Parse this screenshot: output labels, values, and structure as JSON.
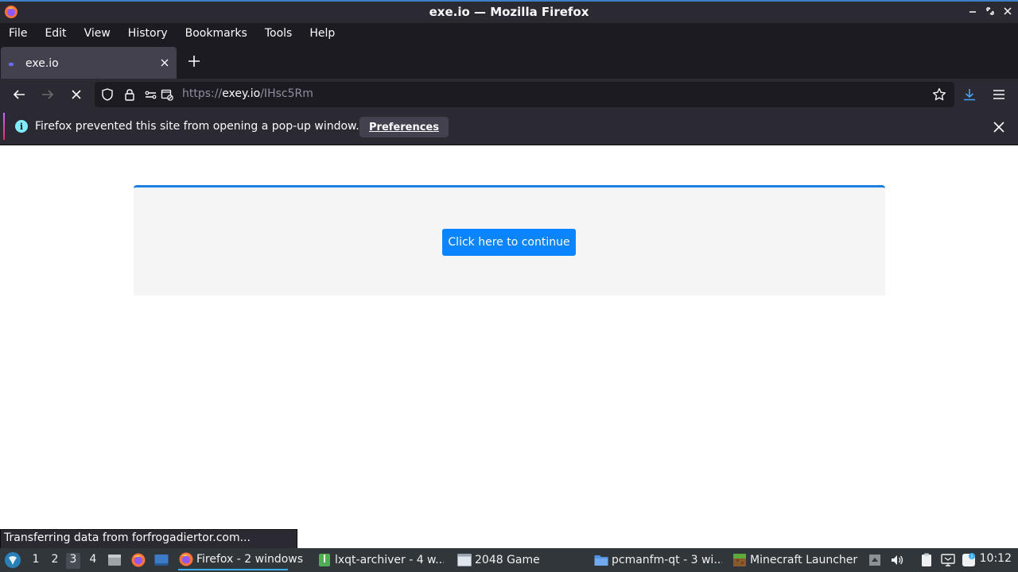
{
  "window": {
    "title": "exe.io — Mozilla Firefox",
    "controls": [
      "minimize-icon",
      "maximize-icon",
      "close-icon"
    ]
  },
  "menu": {
    "file": "File",
    "edit": "Edit",
    "view": "View",
    "history": "History",
    "bookmarks": "Bookmarks",
    "tools": "Tools",
    "help": "Help"
  },
  "tabs": [
    {
      "label": "exe.io",
      "active": true
    }
  ],
  "navbar": {
    "url_scheme": "https://",
    "url_host": "exey.io",
    "url_path": "/IHsc5Rm"
  },
  "notification": {
    "message": "Firefox prevented this site from opening a pop-up window.",
    "button": "Preferences"
  },
  "page": {
    "cta_label": "Click here to continue",
    "accent_color": "#1f7fe0",
    "button_color": "#0a84ff"
  },
  "status": {
    "text": "Transferring data from forfrogadiertor.com..."
  },
  "taskbar": {
    "workspaces": [
      "1",
      "2",
      "3",
      "4"
    ],
    "active_workspace": "3",
    "tasks": [
      {
        "label": "Firefox - 2 windows",
        "icon": "firefox-icon",
        "active": true
      },
      {
        "label": "lxqt-archiver - 4 w...",
        "icon": "archive-icon",
        "active": false
      },
      {
        "label": "2048 Game",
        "icon": "window-icon",
        "active": false
      },
      {
        "label": "pcmanfm-qt - 3 wi...",
        "icon": "folder-icon",
        "active": false
      },
      {
        "label": "Minecraft Launcher",
        "icon": "minecraft-icon",
        "active": false
      }
    ],
    "clock": "10:12"
  }
}
